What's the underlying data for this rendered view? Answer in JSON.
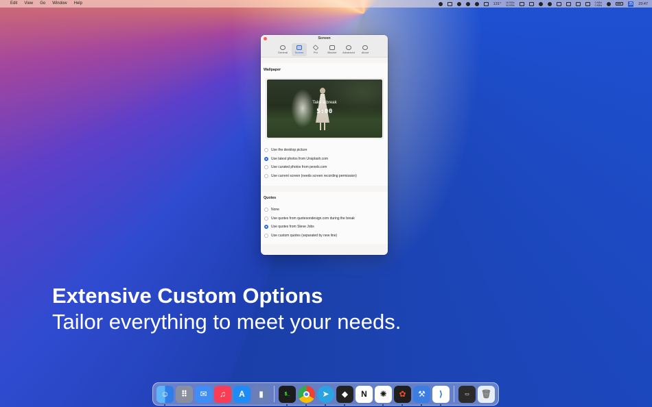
{
  "menubar": {
    "items": [
      "Edit",
      "View",
      "Go",
      "Window",
      "Help"
    ],
    "temperature": "131°",
    "net_up": "16 KB/s",
    "net_down": "34 KB/s",
    "mem_top": "0 KB/s",
    "mem_bottom": "0 KB/s",
    "calendar_day": "25",
    "clock": "23:47"
  },
  "window": {
    "title": "Screen",
    "tabs": [
      {
        "label": "General",
        "icon": "gear-icon"
      },
      {
        "label": "Screen",
        "icon": "picture-icon"
      },
      {
        "label": "Pro",
        "icon": "diamond-icon"
      },
      {
        "label": "Blocker",
        "icon": "blocker-icon"
      },
      {
        "label": "Advanced",
        "icon": "advanced-icon"
      },
      {
        "label": "About",
        "icon": "info-icon"
      }
    ],
    "active_tab": "Screen",
    "wallpaper": {
      "heading": "Wallpaper",
      "preview_text": "Take a break",
      "preview_time": "5:00",
      "options": [
        "Use the desktop picture",
        "Use latest photos from Unsplash.com",
        "Use curated photos from pexels.com",
        "Use current screen (needs screen recording permission)"
      ],
      "selected_index": 1
    },
    "quotes": {
      "heading": "Quotes",
      "options": [
        "None",
        "Use quotes from quotesondesign.com during the break",
        "Use quotes from Steve Jobs",
        "Use custom quotes (separated by new line)"
      ],
      "selected_index": 2
    }
  },
  "hero": {
    "title": "Extensive Custom Options",
    "subtitle": "Tailor everything to meet your needs."
  },
  "dock": {
    "apps": [
      {
        "name": "Finder",
        "icon": "finder-icon",
        "color": "#3a8ef0"
      },
      {
        "name": "Launchpad",
        "icon": "launchpad-icon",
        "color": "#8a8fa0"
      },
      {
        "name": "Mail",
        "icon": "mail-icon",
        "color": "#3f8df5"
      },
      {
        "name": "Music",
        "icon": "music-icon",
        "color": "#fa3c55"
      },
      {
        "name": "App Store",
        "icon": "app-store-icon",
        "color": "#1f8cf5"
      },
      {
        "name": "Xcode-like",
        "icon": "phone-design-icon",
        "color": "#6a7fb5"
      },
      {
        "name": "Terminal",
        "icon": "terminal-icon",
        "color": "#1c1c1c"
      },
      {
        "name": "Chrome",
        "icon": "chrome-icon",
        "color": "#e9e9e9"
      },
      {
        "name": "Telegram",
        "icon": "telegram-icon",
        "color": "#2aa3e0"
      },
      {
        "name": "Box",
        "icon": "box-icon",
        "color": "#222222"
      },
      {
        "name": "Notion",
        "icon": "notion-icon",
        "color": "#ffffff"
      },
      {
        "name": "ChatGPT",
        "icon": "chatgpt-icon",
        "color": "#ffffff"
      },
      {
        "name": "Figma",
        "icon": "figma-icon",
        "color": "#1e1e1e"
      },
      {
        "name": "Xcode",
        "icon": "xcode-icon",
        "color": "#3b7de0"
      },
      {
        "name": "VS Code",
        "icon": "vscode-icon",
        "color": "#ffffff"
      },
      {
        "name": "Console",
        "icon": "console-icon",
        "color": "#2b2b2b"
      },
      {
        "name": "Trash",
        "icon": "trash-icon",
        "color": "#e8eef5"
      }
    ]
  }
}
